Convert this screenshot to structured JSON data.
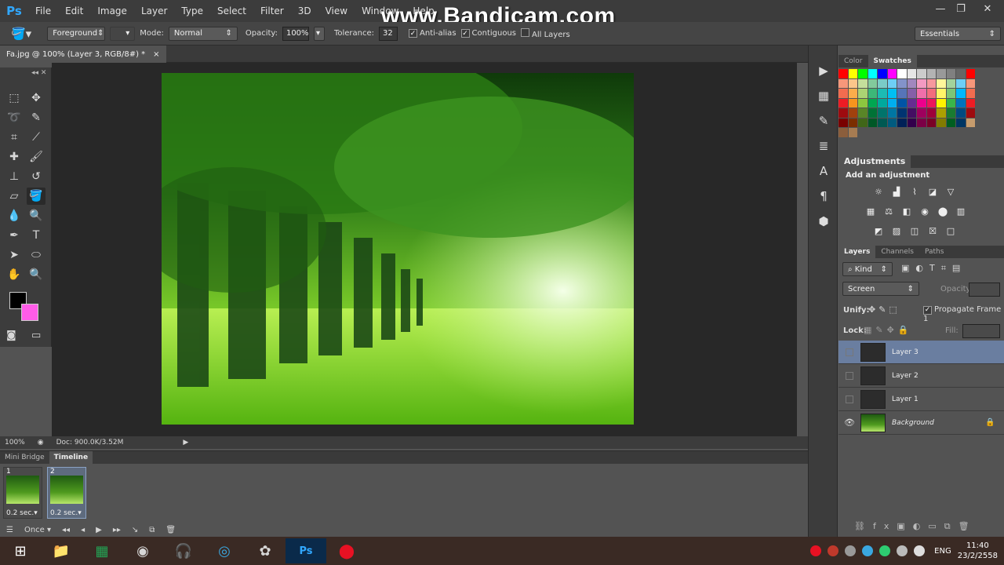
{
  "app": {
    "logo": "Ps",
    "watermark": "www.Bandicam.com"
  },
  "menu": [
    "File",
    "Edit",
    "Image",
    "Layer",
    "Type",
    "Select",
    "Filter",
    "3D",
    "View",
    "Window",
    "Help"
  ],
  "window_controls": [
    "—",
    "❐",
    "✕"
  ],
  "options": {
    "preset": "Foreground",
    "mode_label": "Mode:",
    "mode_value": "Normal",
    "opacity_label": "Opacity:",
    "opacity_value": "100%",
    "tolerance_label": "Tolerance:",
    "tolerance_value": "32",
    "antialias": "Anti-alias",
    "contiguous": "Contiguous",
    "all_layers": "All Layers",
    "workspace": "Essentials"
  },
  "document": {
    "tab_title": "Fa.jpg @ 100% (Layer 3, RGB/8#) *",
    "close": "×"
  },
  "status": {
    "zoom": "100%",
    "doc": "Doc: 900.0K/3.52M"
  },
  "timeline": {
    "tabs": [
      "Mini Bridge",
      "Timeline"
    ],
    "frames": [
      {
        "num": "1",
        "delay": "0.2 sec.▾"
      },
      {
        "num": "2",
        "delay": "0.2 sec.▾"
      }
    ],
    "loop": "Once"
  },
  "panels": {
    "color_tabs": [
      "Color",
      "Swatches"
    ],
    "adjustments_tab": "Adjustments",
    "adjustments_title": "Add an adjustment",
    "layers_tabs": [
      "Layers",
      "Channels",
      "Paths"
    ],
    "kind": "Kind",
    "blend_mode": "Screen",
    "opacity_label": "Opacity:",
    "unify_label": "Unify:",
    "propagate": "Propagate Frame 1",
    "lock_label": "Lock:",
    "fill_label": "Fill:"
  },
  "layers": [
    {
      "name": "Layer 3",
      "selected": true
    },
    {
      "name": "Layer 2",
      "selected": false
    },
    {
      "name": "Layer 1",
      "selected": false
    },
    {
      "name": "Background",
      "selected": false
    }
  ],
  "swatches": [
    "#ff0000",
    "#ffff00",
    "#00ff00",
    "#00ffff",
    "#0000ff",
    "#ff00ff",
    "#ffffff",
    "#e6e6e6",
    "#cccccc",
    "#b3b3b3",
    "#999999",
    "#808080",
    "#666666",
    "#ff0000",
    "#f7977a",
    "#fdc68a",
    "#c4df9b",
    "#82ca9c",
    "#7accc8",
    "#6ecff6",
    "#8393ca",
    "#a187be",
    "#f49ac2",
    "#f6989d",
    "#fff79a",
    "#a2d39c",
    "#6dcff6",
    "#f7977a",
    "#f26c4f",
    "#fbad4b",
    "#acd373",
    "#3cb878",
    "#1cbbb4",
    "#00bff3",
    "#5674b9",
    "#855fa8",
    "#f06eaa",
    "#f26d7d",
    "#fff568",
    "#7cc576",
    "#00b7ff",
    "#f26c4f",
    "#ed1c24",
    "#f7941d",
    "#8dc63f",
    "#00a651",
    "#00a99d",
    "#00aeef",
    "#0054a6",
    "#662d91",
    "#ec008c",
    "#ed145b",
    "#fff200",
    "#39b54a",
    "#0072bc",
    "#ed1c24",
    "#9e0b0f",
    "#a0410d",
    "#598527",
    "#007236",
    "#00746b",
    "#0076a3",
    "#003471",
    "#440e62",
    "#9e005d",
    "#9e0039",
    "#aba000",
    "#197b30",
    "#004a80",
    "#9e0b0f",
    "#790000",
    "#7b2e00",
    "#406618",
    "#005826",
    "#005952",
    "#005b7f",
    "#002157",
    "#32004b",
    "#7b0046",
    "#7a0026",
    "#827b00",
    "#005e20",
    "#003663",
    "#c69c6d",
    "#8b5e3c",
    "#a67c52"
  ],
  "taskbar": {
    "lang": "ENG",
    "time": "11:40",
    "date": "23/2/2558"
  }
}
